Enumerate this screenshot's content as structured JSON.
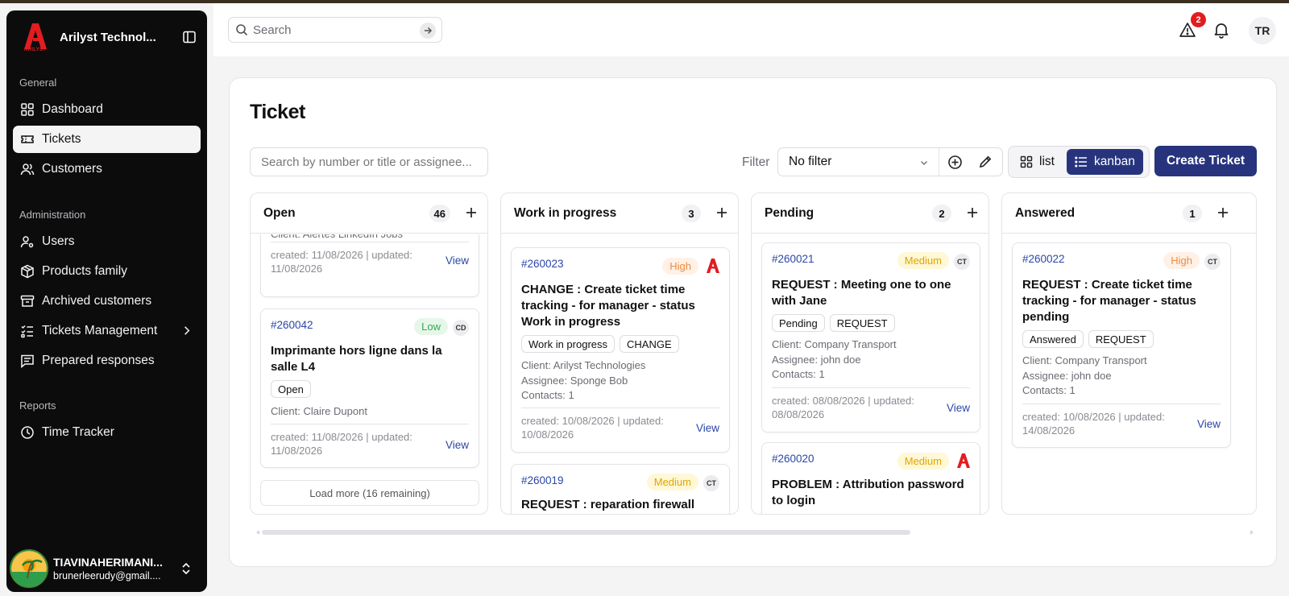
{
  "app": {
    "name": "Arilyst Technol...",
    "logo_text": "ARILYST"
  },
  "sidebar": {
    "sections": [
      {
        "title": "General",
        "items": [
          {
            "label": "Dashboard",
            "icon": "dashboard-icon"
          },
          {
            "label": "Tickets",
            "icon": "ticket-icon",
            "active": true
          },
          {
            "label": "Customers",
            "icon": "users-icon"
          }
        ]
      },
      {
        "title": "Administration",
        "items": [
          {
            "label": "Users",
            "icon": "user-cog-icon"
          },
          {
            "label": "Products family",
            "icon": "package-icon"
          },
          {
            "label": "Archived customers",
            "icon": "archive-icon"
          },
          {
            "label": "Tickets Management",
            "icon": "list-checks-icon"
          },
          {
            "label": "Prepared responses",
            "icon": "message-icon"
          }
        ]
      },
      {
        "title": "Reports",
        "items": [
          {
            "label": "Time Tracker",
            "icon": "clock-icon"
          }
        ]
      }
    ],
    "user": {
      "name": "TIAVINAHERIMANI...",
      "email": "brunerleerudy@gmail...."
    }
  },
  "topbar": {
    "search_placeholder": "Search",
    "alert_count": "2",
    "avatar_initials": "TR"
  },
  "page": {
    "title": "Ticket",
    "search_placeholder": "Search by number or title or assignee...",
    "filter_label": "Filter",
    "filter_value": "No filter",
    "view_list": "list",
    "view_kanban": "kanban",
    "create_label": "Create Ticket"
  },
  "columns": [
    {
      "title": "Open",
      "count": "46",
      "load_more": "Load more (16 remaining)",
      "partial_card": {
        "client": "Client: Alertes LinkedIn Jobs",
        "dates": "created: 11/08/2026 | updated: 11/08/2026",
        "view": "View"
      },
      "cards": [
        {
          "number": "#260042",
          "priority": "Low",
          "priority_color": "#34a853",
          "assignee_initials": "CD",
          "title": "Imprimante hors ligne dans la salle L4",
          "tags": [
            "Open"
          ],
          "client": "Client: Claire Dupont",
          "dates": "created: 11/08/2026 | updated: 11/08/2026",
          "view": "View"
        }
      ]
    },
    {
      "title": "Work in progress",
      "count": "3",
      "cards": [
        {
          "number": "#260023",
          "priority": "High",
          "priority_color": "#f08a3c",
          "title": "CHANGE : Create ticket time tracking - for manager - status Work in progress",
          "tags": [
            "Work in progress",
            "CHANGE"
          ],
          "client": "Client: Arilyst Technologies",
          "assignee": "Assignee: Sponge Bob",
          "contacts": "Contacts: 1",
          "dates": "created: 10/08/2026 | updated: 10/08/2026",
          "view": "View"
        },
        {
          "number": "#260019",
          "priority": "Medium",
          "priority_color": "#e0a400",
          "assignee_initials": "CT",
          "title": "REQUEST : reparation firewall"
        }
      ]
    },
    {
      "title": "Pending",
      "count": "2",
      "cards": [
        {
          "number": "#260021",
          "priority": "Medium",
          "priority_color": "#e0a400",
          "assignee_initials": "CT",
          "title": "REQUEST : Meeting one to one with Jane",
          "tags": [
            "Pending",
            "REQUEST"
          ],
          "client": "Client: Company Transport",
          "assignee": "Assignee: john doe",
          "contacts": "Contacts: 1",
          "dates": "created: 08/08/2026 | updated: 08/08/2026",
          "view": "View"
        },
        {
          "number": "#260020",
          "priority": "Medium",
          "priority_color": "#e0a400",
          "title": "PROBLEM : Attribution password to login"
        }
      ]
    },
    {
      "title": "Answered",
      "count": "1",
      "cards": [
        {
          "number": "#260022",
          "priority": "High",
          "priority_color": "#f08a3c",
          "assignee_initials": "CT",
          "title": "REQUEST : Create ticket time tracking - for manager - status pending",
          "tags": [
            "Answered",
            "REQUEST"
          ],
          "client": "Client: Company Transport",
          "assignee": "Assignee: john doe",
          "contacts": "Contacts: 1",
          "dates": "created: 10/08/2026 | updated: 14/08/2026",
          "view": "View"
        }
      ]
    }
  ]
}
